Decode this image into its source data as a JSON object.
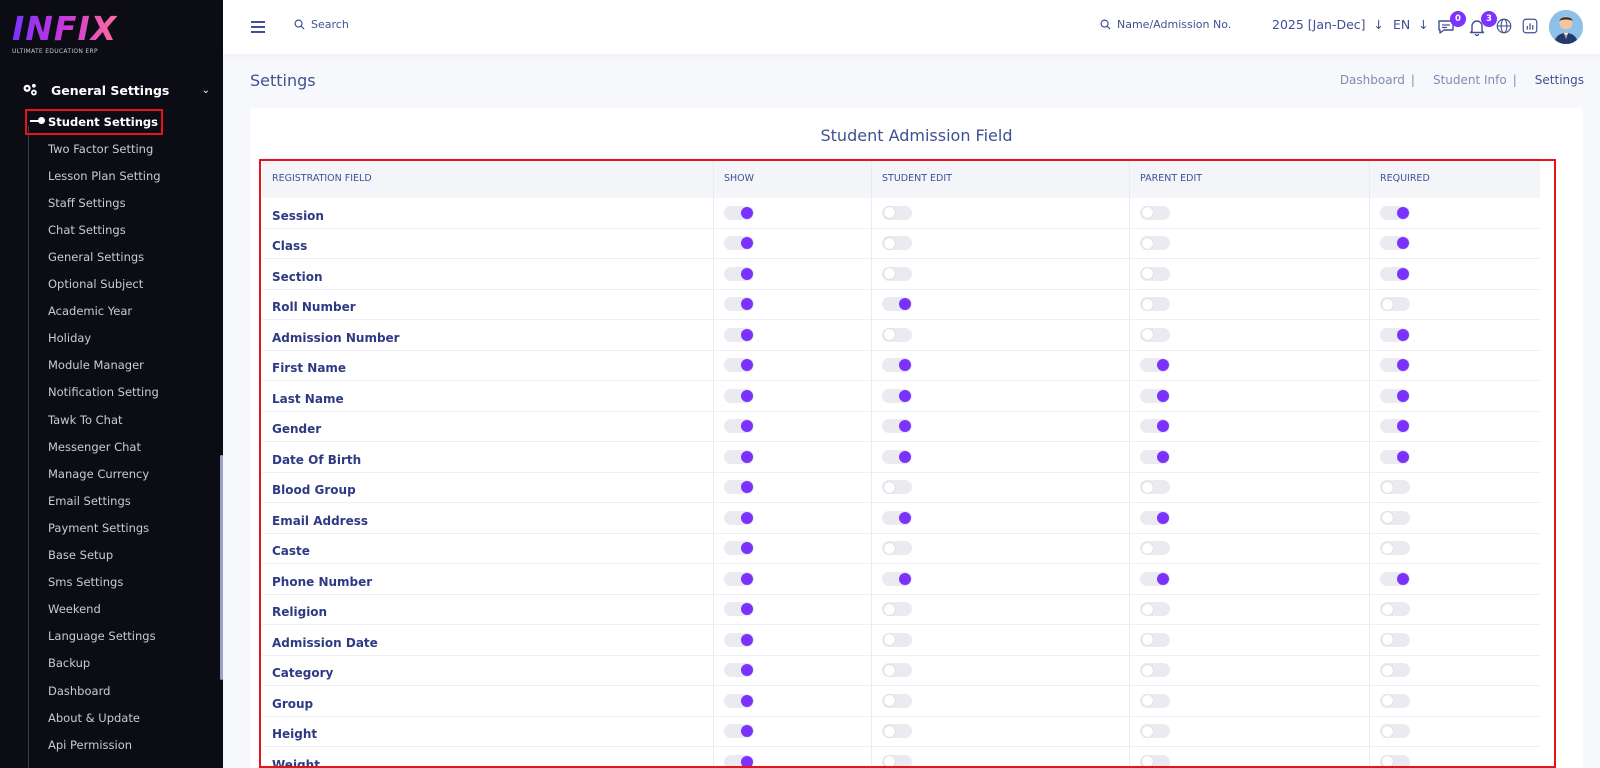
{
  "sidebar": {
    "logo_text": "INFIX",
    "logo_subtitle": "ULTIMATE EDUCATION ERP",
    "section_label": "General Settings",
    "items": [
      {
        "label": "Student Settings",
        "active": true
      },
      {
        "label": "Two Factor Setting"
      },
      {
        "label": "Lesson Plan Setting"
      },
      {
        "label": "Staff Settings"
      },
      {
        "label": "Chat Settings"
      },
      {
        "label": "General Settings"
      },
      {
        "label": "Optional Subject"
      },
      {
        "label": "Academic Year"
      },
      {
        "label": "Holiday"
      },
      {
        "label": "Module Manager"
      },
      {
        "label": "Notification Setting"
      },
      {
        "label": "Tawk To Chat"
      },
      {
        "label": "Messenger Chat"
      },
      {
        "label": "Manage Currency"
      },
      {
        "label": "Email Settings"
      },
      {
        "label": "Payment Settings"
      },
      {
        "label": "Base Setup"
      },
      {
        "label": "Sms Settings"
      },
      {
        "label": "Weekend"
      },
      {
        "label": "Language Settings"
      },
      {
        "label": "Backup"
      },
      {
        "label": "Dashboard"
      },
      {
        "label": "About & Update"
      },
      {
        "label": "Api Permission"
      }
    ]
  },
  "header": {
    "search_placeholder": "Search",
    "student_search_placeholder": "Name/Admission No.",
    "academic_year": "2025 [Jan-Dec]",
    "language": "EN",
    "messages_count": "0",
    "notifications_count": "3"
  },
  "page": {
    "title": "Settings",
    "breadcrumb": [
      "Dashboard",
      "Student Info",
      "Settings"
    ],
    "card_title": "Student Admission Field"
  },
  "table": {
    "headers": [
      "REGISTRATION FIELD",
      "SHOW",
      "STUDENT EDIT",
      "PARENT EDIT",
      "REQUIRED"
    ],
    "rows": [
      {
        "field": "Session",
        "show": true,
        "student_edit": false,
        "parent_edit": false,
        "required": true
      },
      {
        "field": "Class",
        "show": true,
        "student_edit": false,
        "parent_edit": false,
        "required": true
      },
      {
        "field": "Section",
        "show": true,
        "student_edit": false,
        "parent_edit": false,
        "required": true
      },
      {
        "field": "Roll Number",
        "show": true,
        "student_edit": true,
        "parent_edit": false,
        "required": false
      },
      {
        "field": "Admission Number",
        "show": true,
        "student_edit": false,
        "parent_edit": false,
        "required": true
      },
      {
        "field": "First Name",
        "show": true,
        "student_edit": true,
        "parent_edit": true,
        "required": true
      },
      {
        "field": "Last Name",
        "show": true,
        "student_edit": true,
        "parent_edit": true,
        "required": true
      },
      {
        "field": "Gender",
        "show": true,
        "student_edit": true,
        "parent_edit": true,
        "required": true
      },
      {
        "field": "Date Of Birth",
        "show": true,
        "student_edit": true,
        "parent_edit": true,
        "required": true
      },
      {
        "field": "Blood Group",
        "show": true,
        "student_edit": false,
        "parent_edit": false,
        "required": false
      },
      {
        "field": "Email Address",
        "show": true,
        "student_edit": true,
        "parent_edit": true,
        "required": false
      },
      {
        "field": "Caste",
        "show": true,
        "student_edit": false,
        "parent_edit": false,
        "required": false
      },
      {
        "field": "Phone Number",
        "show": true,
        "student_edit": true,
        "parent_edit": true,
        "required": true
      },
      {
        "field": "Religion",
        "show": true,
        "student_edit": false,
        "parent_edit": false,
        "required": false
      },
      {
        "field": "Admission Date",
        "show": true,
        "student_edit": false,
        "parent_edit": false,
        "required": false
      },
      {
        "field": "Category",
        "show": true,
        "student_edit": false,
        "parent_edit": false,
        "required": false
      },
      {
        "field": "Group",
        "show": true,
        "student_edit": false,
        "parent_edit": false,
        "required": false
      },
      {
        "field": "Height",
        "show": true,
        "student_edit": false,
        "parent_edit": false,
        "required": false
      },
      {
        "field": "Weight",
        "show": true,
        "student_edit": false,
        "parent_edit": false,
        "required": false
      }
    ]
  },
  "colors": {
    "accent": "#7c32ff",
    "sidebar_bg": "#0c0d14",
    "text_primary": "#415094",
    "highlight_frame": "#e5141a"
  }
}
